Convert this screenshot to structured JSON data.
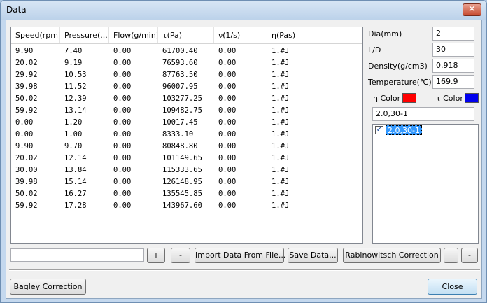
{
  "window": {
    "title": "Data",
    "close_glyph": "✕"
  },
  "table": {
    "headers": [
      "Speed(rpm)",
      "Pressure(...",
      "Flow(g/min)",
      "τ(Pa)",
      "ν(1/s)",
      "η(Pas)",
      ""
    ],
    "rows": [
      [
        "9.90",
        "7.40",
        "0.00",
        "61700.40",
        "0.00",
        "1.#J"
      ],
      [
        "20.02",
        "9.19",
        "0.00",
        "76593.60",
        "0.00",
        "1.#J"
      ],
      [
        "29.92",
        "10.53",
        "0.00",
        "87763.50",
        "0.00",
        "1.#J"
      ],
      [
        "39.98",
        "11.52",
        "0.00",
        "96007.95",
        "0.00",
        "1.#J"
      ],
      [
        "50.02",
        "12.39",
        "0.00",
        "103277.25",
        "0.00",
        "1.#J"
      ],
      [
        "59.92",
        "13.14",
        "0.00",
        "109482.75",
        "0.00",
        "1.#J"
      ],
      [
        "0.00",
        "1.20",
        "0.00",
        "10017.45",
        "0.00",
        "1.#J"
      ],
      [
        "0.00",
        "1.00",
        "0.00",
        "8333.10",
        "0.00",
        "1.#J"
      ],
      [
        "9.90",
        "9.70",
        "0.00",
        "80848.80",
        "0.00",
        "1.#J"
      ],
      [
        "20.02",
        "12.14",
        "0.00",
        "101149.65",
        "0.00",
        "1.#J"
      ],
      [
        "30.00",
        "13.84",
        "0.00",
        "115333.65",
        "0.00",
        "1.#J"
      ],
      [
        "39.98",
        "15.14",
        "0.00",
        "126148.95",
        "0.00",
        "1.#J"
      ],
      [
        "50.02",
        "16.27",
        "0.00",
        "135545.85",
        "0.00",
        "1.#J"
      ],
      [
        "59.92",
        "17.28",
        "0.00",
        "143967.60",
        "0.00",
        "1.#J"
      ]
    ]
  },
  "params": {
    "dia": {
      "label": "Dia(mm)",
      "value": "2"
    },
    "ld": {
      "label": "L/D",
      "value": "30"
    },
    "density": {
      "label": "Density(g/cm3)",
      "value": "0.918"
    },
    "temperature": {
      "label": "Temperature(℃)",
      "value": "169.9"
    },
    "eta_color": {
      "label": "η Color",
      "color": "#ff0000"
    },
    "tau_color": {
      "label": "τ Color",
      "color": "#0000ee"
    }
  },
  "dataset": {
    "name_value": "2.0,30-1",
    "items": [
      {
        "label": "2.0,30-1",
        "checked": true,
        "check_glyph": "✓"
      }
    ]
  },
  "toolbar": {
    "name_input_value": "",
    "add_label": "+",
    "remove_label": "-",
    "import_label": "Import Data From File...",
    "save_label": "Save Data...",
    "rabinowitsch_label": "Rabinowitsch Correction",
    "right_add_label": "+",
    "right_remove_label": "-"
  },
  "footer": {
    "bagley_label": "Bagley Correction",
    "close_label": "Close"
  }
}
